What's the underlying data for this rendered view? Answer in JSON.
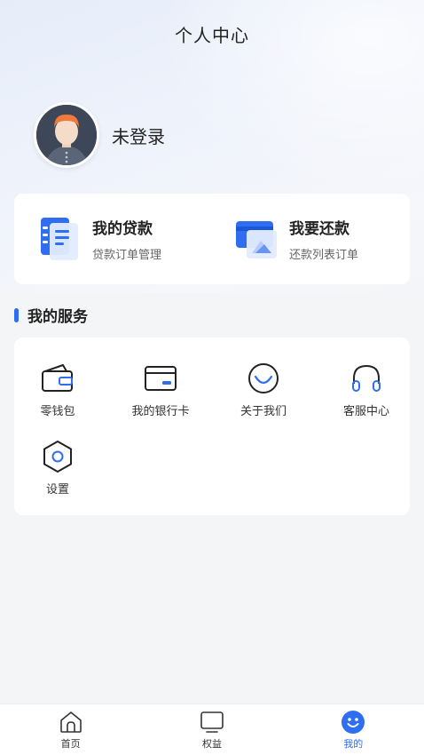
{
  "header": {
    "title": "个人中心"
  },
  "profile": {
    "username": "未登录"
  },
  "loans": [
    {
      "title": "我的贷款",
      "subtitle": "贷款订单管理",
      "icon": "document-icon"
    },
    {
      "title": "我要还款",
      "subtitle": "还款列表订单",
      "icon": "repay-card-icon"
    }
  ],
  "services": {
    "title": "我的服务",
    "items": [
      {
        "label": "零钱包",
        "icon": "wallet-icon"
      },
      {
        "label": "我的银行卡",
        "icon": "bank-card-icon"
      },
      {
        "label": "关于我们",
        "icon": "smile-icon"
      },
      {
        "label": "客服中心",
        "icon": "headset-icon"
      },
      {
        "label": "设置",
        "icon": "hexagon-settings-icon"
      }
    ]
  },
  "tabbar": {
    "items": [
      {
        "label": "首页",
        "icon": "home-icon",
        "active": false
      },
      {
        "label": "权益",
        "icon": "monitor-icon",
        "active": false
      },
      {
        "label": "我的",
        "icon": "smile-face-icon",
        "active": true
      }
    ]
  },
  "colors": {
    "accent": "#2f6ef1",
    "background": "#f4f5f7",
    "card": "#ffffff"
  }
}
